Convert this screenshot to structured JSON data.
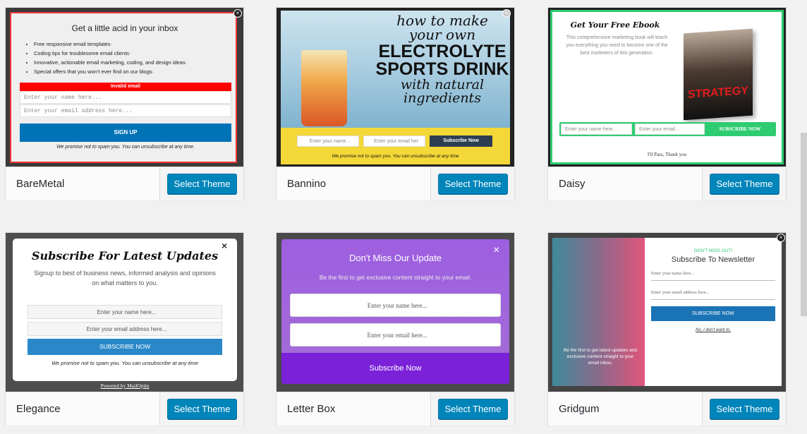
{
  "select_label": "Select Theme",
  "themes": [
    {
      "name": "BareMetal",
      "preview": {
        "title": "Get a little acid in your inbox",
        "bullets": [
          "Free responsive email templates·",
          "Coding tips for troublesome email clients·",
          "Innovative, actionable email marketing, coding, and design ideas·",
          "Special offers that you won't ever find on our blogs·"
        ],
        "error": "Invalid email",
        "name_placeholder": "Enter your name here...",
        "email_placeholder": "Enter your email address here...",
        "button": "SIGN UP",
        "note": "We promise not to spam you. You can unsubscribe at any time."
      }
    },
    {
      "name": "Bannino",
      "preview": {
        "line1": "how to make",
        "line2": "your own",
        "line3": "ELECTROLYTE",
        "line4": "SPORTS DRINK",
        "line5": "with natural",
        "line6": "ingredients",
        "name_placeholder": "Enter your name...",
        "email_placeholder": "Enter your email her",
        "button": "Subscribe Now",
        "note": "We promise not to spam you. You can unsubscribe at any time"
      }
    },
    {
      "name": "Daisy",
      "preview": {
        "title": "Get Your Free Ebook",
        "text": "This comprehensive marketing book will teach you everything you need to become one of the best marketers of this generation.",
        "book_title": "STRATEGY",
        "name_placeholder": "Enter your name here...",
        "email_placeholder": "Enter your email...",
        "button": "SUBSCRIBE NOW",
        "pass": "I'll Pass, Thank you"
      }
    },
    {
      "name": "Elegance",
      "preview": {
        "title": "Subscribe For Latest Updates",
        "text": "Signup to best of business news, informed analysis and opinions on what matters to you.",
        "name_placeholder": "Enter your name here...",
        "email_placeholder": "Enter your email address here...",
        "button": "SUBSCRIBE NOW",
        "note": "We promise not to spam you. You can unsubscribe at any time",
        "powered": "Powered by MailOptin"
      }
    },
    {
      "name": "Letter Box",
      "preview": {
        "title": "Don't Miss Our Update",
        "text": "Be the first to get exclusive content straight to your email.",
        "name_placeholder": "Enter your name here...",
        "email_placeholder": "Enter your email here...",
        "button": "Subscribe Now"
      }
    },
    {
      "name": "Gridgum",
      "preview": {
        "kicker": "DON'T MISS OUT!",
        "title": "Subscribe To Newsletter",
        "name_placeholder": "Enter your name here...",
        "email_placeholder": "Enter your email address here...",
        "button": "SUBSCRIBE NOW",
        "decline": "No, I don't want to.",
        "side_text": "Be the first to get latest updates and exclusive content straight to your email inbox."
      }
    }
  ],
  "colors": {
    "button": "#0085ba",
    "error": "#ff0000",
    "daisy_green": "#2ecc71",
    "letterbox_purple": "#7b22d8",
    "bannino_yellow": "#f4d837"
  }
}
